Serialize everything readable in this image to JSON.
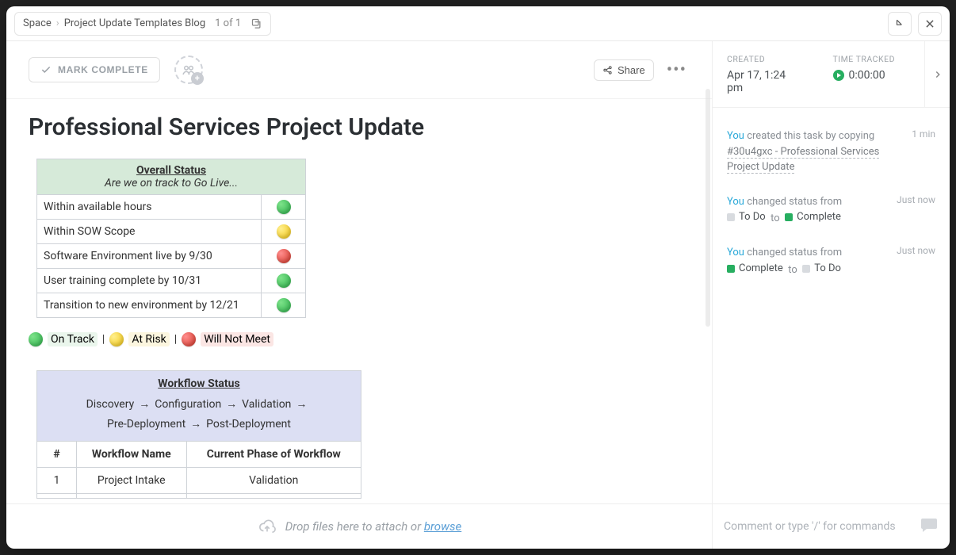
{
  "breadcrumb": {
    "root": "Space",
    "current": "Project Update Templates Blog",
    "count": "1 of 1"
  },
  "header": {
    "mark_complete": "MARK COMPLETE",
    "share": "Share"
  },
  "meta": {
    "created_label": "CREATED",
    "created_value": "Apr 17, 1:24 pm",
    "time_label": "TIME TRACKED",
    "time_value": "0:00:00"
  },
  "doc": {
    "title": "Professional Services Project Update",
    "overall": {
      "header": "Overall Status",
      "subtitle": "Are we on track to Go Live...",
      "rows": [
        {
          "label": "Within available hours",
          "status": "green"
        },
        {
          "label": "Within SOW Scope",
          "status": "yellow"
        },
        {
          "label": "Software Environment live by 9/30",
          "status": "red"
        },
        {
          "label": "User training complete by 10/31",
          "status": "green"
        },
        {
          "label": "Transition to new environment by 12/21",
          "status": "green"
        }
      ]
    },
    "legend": {
      "on_track": "On Track",
      "at_risk": "At Risk",
      "will_not_meet": "Will Not Meet"
    },
    "workflow": {
      "header": "Workflow Status",
      "phases": [
        "Discovery",
        "Configuration",
        "Validation",
        "Pre-Deployment",
        "Post-Deployment"
      ],
      "cols": [
        "#",
        "Workflow Name",
        "Current Phase of Workflow"
      ],
      "rows": [
        {
          "num": "1",
          "name": "Project Intake",
          "phase": "Validation"
        }
      ]
    }
  },
  "activity": {
    "items": [
      {
        "you": "You",
        "text": "created this task by copying ",
        "link": "#30u4gxc - Professional Services Project Update",
        "time": "1 min"
      }
    ],
    "status_changes": [
      {
        "you": "You",
        "lead": "changed status from",
        "from": {
          "label": "To Do",
          "color": "todo"
        },
        "to_word": "to",
        "to": {
          "label": "Complete",
          "color": "complete"
        },
        "time": "Just now"
      },
      {
        "you": "You",
        "lead": "changed status from",
        "from": {
          "label": "Complete",
          "color": "complete"
        },
        "to_word": "to",
        "to": {
          "label": "To Do",
          "color": "todo"
        },
        "time": "Just now"
      }
    ]
  },
  "footer": {
    "drop_text": "Drop files here to attach or ",
    "browse": "browse",
    "comment_placeholder": "Comment or type '/' for commands"
  }
}
